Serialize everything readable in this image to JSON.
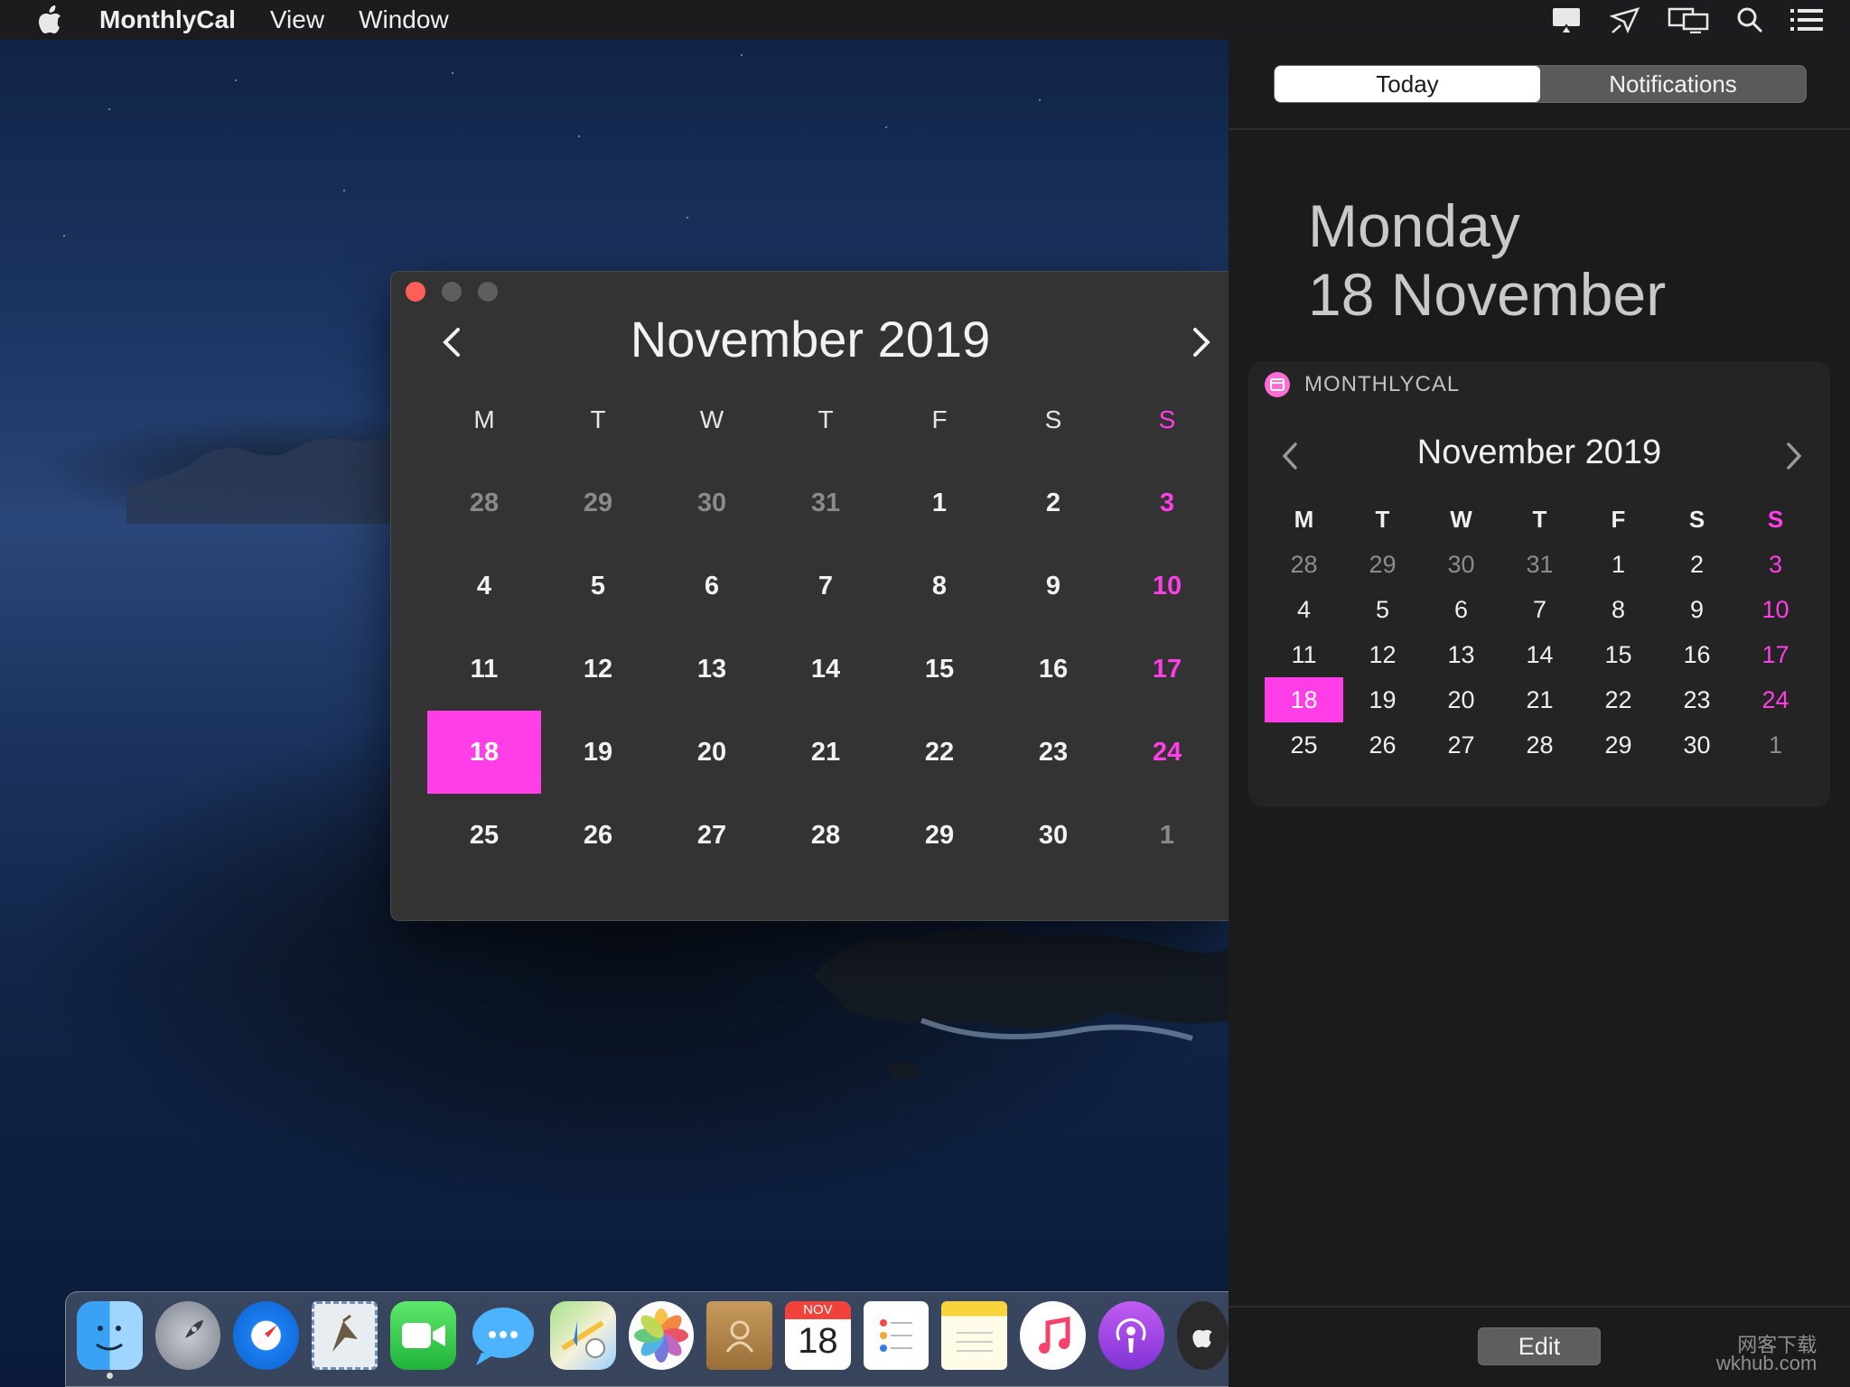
{
  "menubar": {
    "app_name": "MonthlyCal",
    "items": [
      "View",
      "Window"
    ],
    "icons": [
      "airplay-icon",
      "paper-plane-icon",
      "displays-icon",
      "search-icon",
      "notification-list-icon"
    ]
  },
  "calendar_window": {
    "month_title": "November 2019",
    "weekdays": [
      "M",
      "T",
      "W",
      "T",
      "F",
      "S",
      "S"
    ],
    "weeks": [
      [
        "28",
        "29",
        "30",
        "31",
        "1",
        "2",
        "3"
      ],
      [
        "4",
        "5",
        "6",
        "7",
        "8",
        "9",
        "10"
      ],
      [
        "11",
        "12",
        "13",
        "14",
        "15",
        "16",
        "17"
      ],
      [
        "18",
        "19",
        "20",
        "21",
        "22",
        "23",
        "24"
      ],
      [
        "25",
        "26",
        "27",
        "28",
        "29",
        "30",
        "1"
      ]
    ],
    "today": "18",
    "accent_color": "#ff3ee8"
  },
  "notification_center": {
    "tabs": [
      "Today",
      "Notifications"
    ],
    "active_tab": "Today",
    "date_line1": "Monday",
    "date_line2": "18 November",
    "widget": {
      "title": "MONTHLYCAL",
      "month_title": "November 2019",
      "weekdays": [
        "M",
        "T",
        "W",
        "T",
        "F",
        "S",
        "S"
      ],
      "weeks": [
        [
          "28",
          "29",
          "30",
          "31",
          "1",
          "2",
          "3"
        ],
        [
          "4",
          "5",
          "6",
          "7",
          "8",
          "9",
          "10"
        ],
        [
          "11",
          "12",
          "13",
          "14",
          "15",
          "16",
          "17"
        ],
        [
          "18",
          "19",
          "20",
          "21",
          "22",
          "23",
          "24"
        ],
        [
          "25",
          "26",
          "27",
          "28",
          "29",
          "30",
          "1"
        ]
      ],
      "today": "18"
    },
    "edit_label": "Edit"
  },
  "dock": {
    "calendar_icon_month": "NOV",
    "calendar_icon_day": "18",
    "apps": [
      "finder-icon",
      "launchpad-icon",
      "safari-icon",
      "mail-icon",
      "facetime-icon",
      "messages-icon",
      "maps-icon",
      "photos-icon",
      "contacts-icon",
      "calendar-icon",
      "reminders-icon",
      "notes-icon",
      "music-icon",
      "podcasts-icon",
      "app-store-icon"
    ]
  },
  "watermark": {
    "line1": "网客下载",
    "line2": "wkhub.com"
  }
}
